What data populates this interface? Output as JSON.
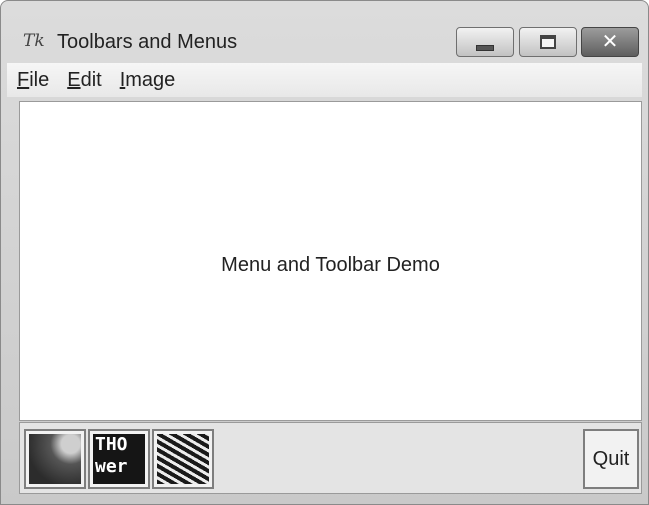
{
  "window": {
    "title": "Toolbars and Menus",
    "icon": "tk-feather-icon",
    "controls": [
      "minimize-icon",
      "maximize-icon",
      "close-icon"
    ]
  },
  "menubar": {
    "items": [
      {
        "label": "File",
        "mnemonic": "F"
      },
      {
        "label": "Edit",
        "mnemonic": "E"
      },
      {
        "label": "Image",
        "mnemonic": "I"
      }
    ]
  },
  "main": {
    "label": "Menu and Toolbar Demo"
  },
  "toolbar": {
    "image_buttons": [
      {
        "icon": "image-thumbnail-icon"
      },
      {
        "icon": "text-image-thumbnail-icon",
        "image_text": "THO wer"
      },
      {
        "icon": "pattern-image-thumbnail-icon"
      }
    ],
    "quit_label": "Quit"
  },
  "colors": {
    "window_frame": "#c9c9c9",
    "content_bg": "#ffffff",
    "toolbar_bg": "#e4e4e4"
  }
}
